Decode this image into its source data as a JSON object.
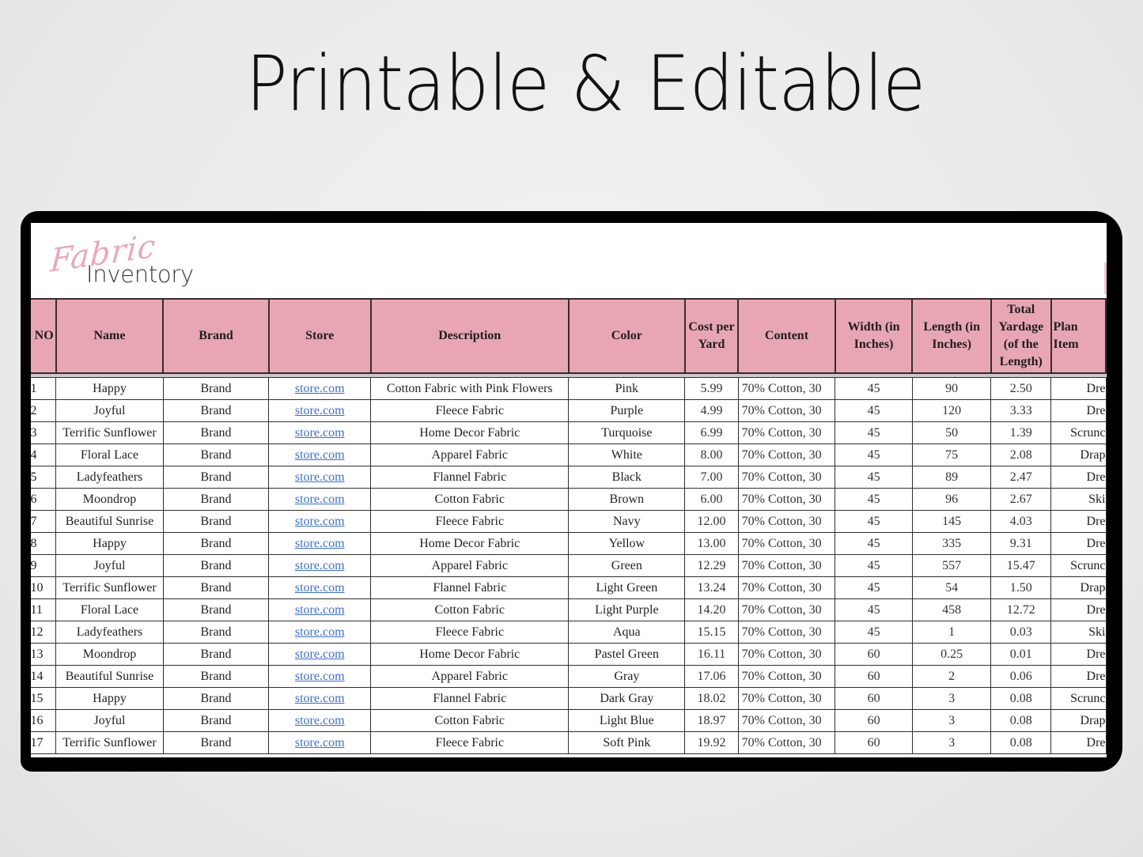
{
  "headline": "Printable & Editable",
  "logo": {
    "script": "Fabric",
    "word": "Inventory"
  },
  "colors": {
    "header_bg": "#e8a6b4",
    "logo_pink": "#e7a9b8",
    "link": "#3b6fd3",
    "device": "#000000"
  },
  "table": {
    "headers": [
      "NO",
      "Name",
      "Brand",
      "Store",
      "Description",
      "Color",
      "Cost per Yard",
      "Content",
      "Width (in Inches)",
      "Length (in Inches)",
      "Total Yardage (of the Length)",
      "Plan Item"
    ],
    "rows": [
      {
        "no": "1",
        "name": "Happy",
        "brand": "Brand",
        "store": "store.com",
        "description": "Cotton Fabric with Pink Flowers",
        "color": "Pink",
        "cost": "5.99",
        "content": "70% Cotton, 30",
        "width": "45",
        "length": "90",
        "yardage": "2.50",
        "plan": "Dre"
      },
      {
        "no": "2",
        "name": "Joyful",
        "brand": "Brand",
        "store": "store.com",
        "description": "Fleece Fabric",
        "color": "Purple",
        "cost": "4.99",
        "content": "70% Cotton, 30",
        "width": "45",
        "length": "120",
        "yardage": "3.33",
        "plan": "Dre"
      },
      {
        "no": "3",
        "name": "Terrific Sunflower",
        "brand": "Brand",
        "store": "store.com",
        "description": "Home Decor Fabric",
        "color": "Turquoise",
        "cost": "6.99",
        "content": "70% Cotton, 30",
        "width": "45",
        "length": "50",
        "yardage": "1.39",
        "plan": "Scrunc"
      },
      {
        "no": "4",
        "name": "Floral Lace",
        "brand": "Brand",
        "store": "store.com",
        "description": "Apparel Fabric",
        "color": "White",
        "cost": "8.00",
        "content": "70% Cotton, 30",
        "width": "45",
        "length": "75",
        "yardage": "2.08",
        "plan": "Drap"
      },
      {
        "no": "5",
        "name": "Ladyfeathers",
        "brand": "Brand",
        "store": "store.com",
        "description": "Flannel Fabric",
        "color": "Black",
        "cost": "7.00",
        "content": "70% Cotton, 30",
        "width": "45",
        "length": "89",
        "yardage": "2.47",
        "plan": "Dre"
      },
      {
        "no": "6",
        "name": "Moondrop",
        "brand": "Brand",
        "store": "store.com",
        "description": "Cotton Fabric",
        "color": "Brown",
        "cost": "6.00",
        "content": "70% Cotton, 30",
        "width": "45",
        "length": "96",
        "yardage": "2.67",
        "plan": "Ski"
      },
      {
        "no": "7",
        "name": "Beautiful Sunrise",
        "brand": "Brand",
        "store": "store.com",
        "description": "Fleece Fabric",
        "color": "Navy",
        "cost": "12.00",
        "content": "70% Cotton, 30",
        "width": "45",
        "length": "145",
        "yardage": "4.03",
        "plan": "Dre"
      },
      {
        "no": "8",
        "name": "Happy",
        "brand": "Brand",
        "store": "store.com",
        "description": "Home Decor Fabric",
        "color": "Yellow",
        "cost": "13.00",
        "content": "70% Cotton, 30",
        "width": "45",
        "length": "335",
        "yardage": "9.31",
        "plan": "Dre"
      },
      {
        "no": "9",
        "name": "Joyful",
        "brand": "Brand",
        "store": "store.com",
        "description": "Apparel Fabric",
        "color": "Green",
        "cost": "12.29",
        "content": "70% Cotton, 30",
        "width": "45",
        "length": "557",
        "yardage": "15.47",
        "plan": "Scrunc"
      },
      {
        "no": "10",
        "name": "Terrific Sunflower",
        "brand": "Brand",
        "store": "store.com",
        "description": "Flannel Fabric",
        "color": "Light Green",
        "cost": "13.24",
        "content": "70% Cotton, 30",
        "width": "45",
        "length": "54",
        "yardage": "1.50",
        "plan": "Drap"
      },
      {
        "no": "11",
        "name": "Floral Lace",
        "brand": "Brand",
        "store": "store.com",
        "description": "Cotton Fabric",
        "color": "Light Purple",
        "cost": "14.20",
        "content": "70% Cotton, 30",
        "width": "45",
        "length": "458",
        "yardage": "12.72",
        "plan": "Dre"
      },
      {
        "no": "12",
        "name": "Ladyfeathers",
        "brand": "Brand",
        "store": "store.com",
        "description": "Fleece Fabric",
        "color": "Aqua",
        "cost": "15.15",
        "content": "70% Cotton, 30",
        "width": "45",
        "length": "1",
        "yardage": "0.03",
        "plan": "Ski"
      },
      {
        "no": "13",
        "name": "Moondrop",
        "brand": "Brand",
        "store": "store.com",
        "description": "Home Decor Fabric",
        "color": "Pastel Green",
        "cost": "16.11",
        "content": "70% Cotton, 30",
        "width": "60",
        "length": "0.25",
        "yardage": "0.01",
        "plan": "Dre"
      },
      {
        "no": "14",
        "name": "Beautiful Sunrise",
        "brand": "Brand",
        "store": "store.com",
        "description": "Apparel Fabric",
        "color": "Gray",
        "cost": "17.06",
        "content": "70% Cotton, 30",
        "width": "60",
        "length": "2",
        "yardage": "0.06",
        "plan": "Dre"
      },
      {
        "no": "15",
        "name": "Happy",
        "brand": "Brand",
        "store": "store.com",
        "description": "Flannel Fabric",
        "color": "Dark Gray",
        "cost": "18.02",
        "content": "70% Cotton, 30",
        "width": "60",
        "length": "3",
        "yardage": "0.08",
        "plan": "Scrunc"
      },
      {
        "no": "16",
        "name": "Joyful",
        "brand": "Brand",
        "store": "store.com",
        "description": "Cotton Fabric",
        "color": "Light Blue",
        "cost": "18.97",
        "content": "70% Cotton, 30",
        "width": "60",
        "length": "3",
        "yardage": "0.08",
        "plan": "Drap"
      },
      {
        "no": "17",
        "name": "Terrific Sunflower",
        "brand": "Brand",
        "store": "store.com",
        "description": "Fleece Fabric",
        "color": "Soft Pink",
        "cost": "19.92",
        "content": "70% Cotton, 30",
        "width": "60",
        "length": "3",
        "yardage": "0.08",
        "plan": "Dre"
      }
    ]
  }
}
